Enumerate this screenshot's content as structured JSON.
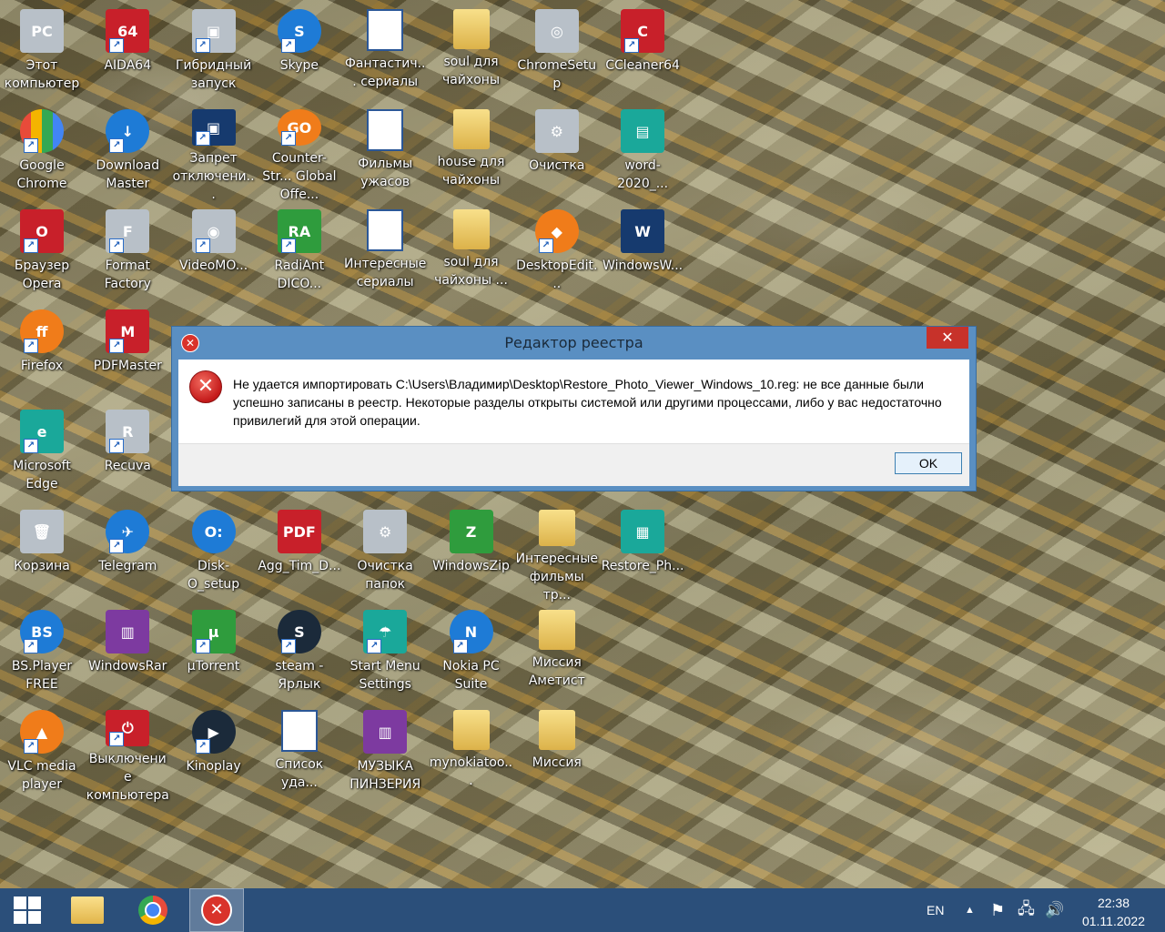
{
  "desktop": {
    "icons": [
      {
        "label": "Этот компьютер",
        "glyph": "PC",
        "style": "g-gray",
        "shortcut": false,
        "col": 0,
        "row": 0
      },
      {
        "label": "AIDA64",
        "glyph": "64",
        "style": "g-red",
        "shortcut": true,
        "col": 1,
        "row": 0
      },
      {
        "label": "Гибридный запуск",
        "glyph": "▣",
        "style": "g-gray",
        "shortcut": true,
        "col": 2,
        "row": 0
      },
      {
        "label": "Skype",
        "glyph": "S",
        "style": "g-blue",
        "shortcut": true,
        "col": 3,
        "row": 0
      },
      {
        "label": "Фантастич... сериалы",
        "glyph": "W",
        "style": "g-word",
        "shortcut": false,
        "col": 4,
        "row": 0
      },
      {
        "label": "soul для чайхоны",
        "glyph": "",
        "style": "g-folder",
        "shortcut": false,
        "col": 5,
        "row": 0
      },
      {
        "label": "ChromeSetup",
        "glyph": "◎",
        "style": "g-gray",
        "shortcut": false,
        "col": 6,
        "row": 0
      },
      {
        "label": "CCleaner64",
        "glyph": "C",
        "style": "g-red",
        "shortcut": true,
        "col": 7,
        "row": 0
      },
      {
        "label": "Google Chrome",
        "glyph": "",
        "style": "g-multi",
        "shortcut": true,
        "col": 0,
        "row": 1
      },
      {
        "label": "Download Master",
        "glyph": "↓",
        "style": "g-blue",
        "shortcut": true,
        "col": 1,
        "row": 1
      },
      {
        "label": "Запрет отключени...",
        "glyph": "▣",
        "style": "g-navy",
        "shortcut": true,
        "col": 2,
        "row": 1
      },
      {
        "label": "Counter-Str... Global Offe...",
        "glyph": "GO",
        "style": "g-orange",
        "shortcut": true,
        "col": 3,
        "row": 1
      },
      {
        "label": "Фильмы ужасов",
        "glyph": "W",
        "style": "g-word",
        "shortcut": false,
        "col": 4,
        "row": 1
      },
      {
        "label": "house для чайхоны",
        "glyph": "",
        "style": "g-folder",
        "shortcut": false,
        "col": 5,
        "row": 1
      },
      {
        "label": "Очистка",
        "glyph": "⚙",
        "style": "g-gray",
        "shortcut": false,
        "col": 6,
        "row": 1
      },
      {
        "label": "word-2020_...",
        "glyph": "▤",
        "style": "g-teal",
        "shortcut": false,
        "col": 7,
        "row": 1
      },
      {
        "label": "Браузер Opera",
        "glyph": "O",
        "style": "g-red",
        "shortcut": true,
        "col": 0,
        "row": 2
      },
      {
        "label": "Format Factory",
        "glyph": "F",
        "style": "g-gray",
        "shortcut": true,
        "col": 1,
        "row": 2
      },
      {
        "label": "VideoMO...",
        "glyph": "◉",
        "style": "g-gray",
        "shortcut": true,
        "col": 2,
        "row": 2
      },
      {
        "label": "RadiAnt DICO...",
        "glyph": "RA",
        "style": "g-green",
        "shortcut": true,
        "col": 3,
        "row": 2
      },
      {
        "label": "Интересные сериалы",
        "glyph": "W",
        "style": "g-word",
        "shortcut": false,
        "col": 4,
        "row": 2
      },
      {
        "label": "soul для чайхоны ...",
        "glyph": "",
        "style": "g-folder",
        "shortcut": false,
        "col": 5,
        "row": 2
      },
      {
        "label": "DesktopEdit...",
        "glyph": "◆",
        "style": "g-orange",
        "shortcut": true,
        "col": 6,
        "row": 2
      },
      {
        "label": "WindowsW...",
        "glyph": "W",
        "style": "g-navy",
        "shortcut": false,
        "col": 7,
        "row": 2
      },
      {
        "label": "Firefox",
        "glyph": "ff",
        "style": "g-orange",
        "shortcut": true,
        "col": 0,
        "row": 3
      },
      {
        "label": "PDFMaster",
        "glyph": "M",
        "style": "g-red",
        "shortcut": true,
        "col": 1,
        "row": 3
      },
      {
        "label": "Microsoft Edge",
        "glyph": "e",
        "style": "g-teal",
        "shortcut": true,
        "col": 0,
        "row": 4
      },
      {
        "label": "Recuva",
        "glyph": "R",
        "style": "g-gray",
        "shortcut": true,
        "col": 1,
        "row": 4
      },
      {
        "label": "Корзина",
        "glyph": "🗑",
        "style": "g-gray",
        "shortcut": false,
        "col": 0,
        "row": 5
      },
      {
        "label": "Telegram",
        "glyph": "✈",
        "style": "g-blue",
        "shortcut": true,
        "col": 1,
        "row": 5
      },
      {
        "label": "Disk-O_setup",
        "glyph": "O:",
        "style": "g-blue",
        "shortcut": false,
        "col": 2,
        "row": 5
      },
      {
        "label": "Agg_Tim_D...",
        "glyph": "PDF",
        "style": "g-red",
        "shortcut": false,
        "col": 3,
        "row": 5
      },
      {
        "label": "Очистка папок",
        "glyph": "⚙",
        "style": "g-gray",
        "shortcut": false,
        "col": 4,
        "row": 5
      },
      {
        "label": "WindowsZip",
        "glyph": "Z",
        "style": "g-green",
        "shortcut": false,
        "col": 5,
        "row": 5
      },
      {
        "label": "Интересные фильмы тр...",
        "glyph": "",
        "style": "g-folder",
        "shortcut": false,
        "col": 6,
        "row": 5
      },
      {
        "label": "Restore_Ph...",
        "glyph": "▦",
        "style": "g-teal",
        "shortcut": false,
        "col": 7,
        "row": 5
      },
      {
        "label": "BS.Player FREE",
        "glyph": "BS",
        "style": "g-blue",
        "shortcut": true,
        "col": 0,
        "row": 6
      },
      {
        "label": "WindowsRar",
        "glyph": "▥",
        "style": "g-purple",
        "shortcut": false,
        "col": 1,
        "row": 6
      },
      {
        "label": "µTorrent",
        "glyph": "µ",
        "style": "g-green",
        "shortcut": true,
        "col": 2,
        "row": 6
      },
      {
        "label": "steam - Ярлык",
        "glyph": "S",
        "style": "g-dark",
        "shortcut": true,
        "col": 3,
        "row": 6
      },
      {
        "label": "Start Menu Settings",
        "glyph": "☂",
        "style": "g-teal",
        "shortcut": true,
        "col": 4,
        "row": 6
      },
      {
        "label": "Nokia PC Suite",
        "glyph": "N",
        "style": "g-blue",
        "shortcut": true,
        "col": 5,
        "row": 6
      },
      {
        "label": "Миссия Аметист",
        "glyph": "",
        "style": "g-folder",
        "shortcut": false,
        "col": 6,
        "row": 6
      },
      {
        "label": "VLC media player",
        "glyph": "▲",
        "style": "g-orange",
        "shortcut": true,
        "col": 0,
        "row": 7
      },
      {
        "label": "Выключение компьютера",
        "glyph": "⏻",
        "style": "g-red",
        "shortcut": true,
        "col": 1,
        "row": 7
      },
      {
        "label": "Kinoplay",
        "glyph": "▶",
        "style": "g-dark",
        "shortcut": true,
        "col": 2,
        "row": 7
      },
      {
        "label": "Список уда...",
        "glyph": "W",
        "style": "g-word",
        "shortcut": false,
        "col": 3,
        "row": 7
      },
      {
        "label": "МУЗЫКА ПИНЗЕРИЯ",
        "glyph": "▥",
        "style": "g-purple",
        "shortcut": false,
        "col": 4,
        "row": 7
      },
      {
        "label": "mynokiatoo...",
        "glyph": "",
        "style": "g-folder",
        "shortcut": false,
        "col": 5,
        "row": 7
      },
      {
        "label": "Миссия",
        "glyph": "",
        "style": "g-folder",
        "shortcut": false,
        "col": 6,
        "row": 7
      }
    ]
  },
  "dialog": {
    "title": "Редактор реестра",
    "close_glyph": "✕",
    "title_icon_glyph": "✕",
    "error_icon_glyph": "✕",
    "message": "Не удается импортировать C:\\Users\\Владимир\\Desktop\\Restore_Photo_Viewer_Windows_10.reg: не все данные были успешно записаны в реестр. Некоторые разделы открыты системой или другими процессами, либо у вас недостаточно привилегий для этой операции.",
    "ok_label": "OK"
  },
  "taskbar": {
    "language": "EN",
    "time": "22:38",
    "date": "01.11.2022",
    "error_glyph": "✕",
    "tray_icons": [
      "up-arrow-icon",
      "flag-icon",
      "network-icon",
      "volume-icon"
    ],
    "tray_glyphs": {
      "up": "▲",
      "flag": "⚑",
      "network": "🖧",
      "volume": "🔊"
    }
  }
}
